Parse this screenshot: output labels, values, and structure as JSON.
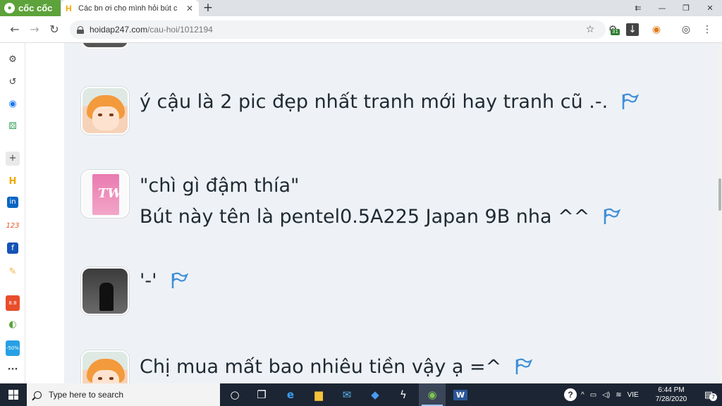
{
  "browser": {
    "brand": "cốc cốc",
    "tab_title": "Các bn ơi cho mình hỏi bút c",
    "tab_close": "✕",
    "new_tab": "+",
    "address_host": "hoidap247.com",
    "address_path": "/cau-hoi/1012194",
    "controls": {
      "menu": "⇇",
      "minimize": "—",
      "maximize": "❐",
      "close": "✕"
    },
    "toolbar_badge": "31"
  },
  "sidebar": {
    "items": [
      "settings",
      "history",
      "messenger",
      "games",
      "add",
      "hoidap247",
      "linkedin",
      "123",
      "facebook",
      "notes",
      "shop",
      "cococ",
      "sale"
    ],
    "shop_badge": "8.8",
    "sale_badge": "-50%",
    "more": "···"
  },
  "comments": [
    {
      "avatar": "umaru",
      "lines": [
        "ý cậu là 2 pic đẹp nhất tranh mới hay tranh cũ .-."
      ]
    },
    {
      "avatar": "twice",
      "lines": [
        "\"chì gì đậm thía\"",
        "Bút này tên là pentel0.5A225 Japan 9B  nha ^^"
      ]
    },
    {
      "avatar": "dark",
      "lines": [
        "'-'"
      ]
    },
    {
      "avatar": "umaru",
      "lines": [
        "Chị mua mất bao nhiêu tiền vậy ạ =^"
      ]
    }
  ],
  "taskbar": {
    "search_placeholder": "Type here to search",
    "language": "VIE",
    "time": "6:44 PM",
    "date": "7/28/2020",
    "notifications": "7"
  },
  "colors": {
    "flag": "#3f8fd8",
    "brand": "#5da23a",
    "content_bg": "#eef2f6",
    "taskbar": "#1c2533"
  }
}
